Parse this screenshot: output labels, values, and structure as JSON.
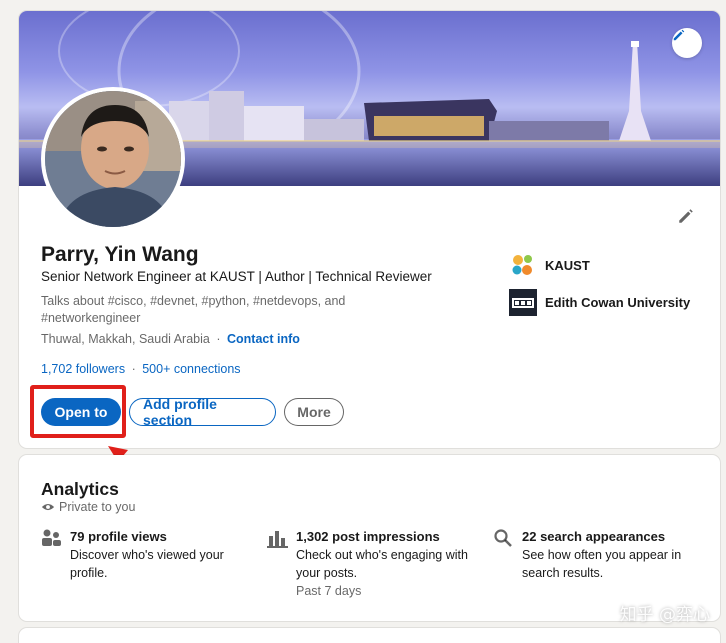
{
  "profile": {
    "name": "Parry, Yin Wang",
    "headline": "Senior Network Engineer at KAUST | Author | Technical Reviewer",
    "about": "Talks about #cisco, #devnet, #python, #netdevops, and #networkengineer",
    "location": "Thuwal, Makkah, Saudi Arabia",
    "location_sep": "·",
    "contact_info": "Contact info",
    "followers": "1,702 followers",
    "stats_sep": "·",
    "connections": "500+ connections"
  },
  "organizations": [
    {
      "name": "KAUST",
      "icon": "kaust-logo-icon"
    },
    {
      "name": "Edith Cowan University",
      "icon": "ecu-logo-icon"
    }
  ],
  "buttons": {
    "open_to": "Open to",
    "add_section": "Add profile section",
    "more": "More"
  },
  "analytics": {
    "title": "Analytics",
    "privacy": "Private to you",
    "metrics": [
      {
        "title": "79 profile views",
        "desc": "Discover who's viewed your profile.",
        "note": "",
        "icon": "people-icon"
      },
      {
        "title": "1,302 post impressions",
        "desc": "Check out who's engaging with your posts.",
        "note": "Past 7 days",
        "icon": "bar-chart-icon"
      },
      {
        "title": "22 search appearances",
        "desc": "See how often you appear in search results.",
        "note": "",
        "icon": "search-icon"
      }
    ]
  },
  "watermark": "知乎 @弈心",
  "colors": {
    "link": "#0a66c2",
    "primary": "#0a66c2",
    "annotation": "#e0201a",
    "page_bg": "#f3f2ef"
  }
}
